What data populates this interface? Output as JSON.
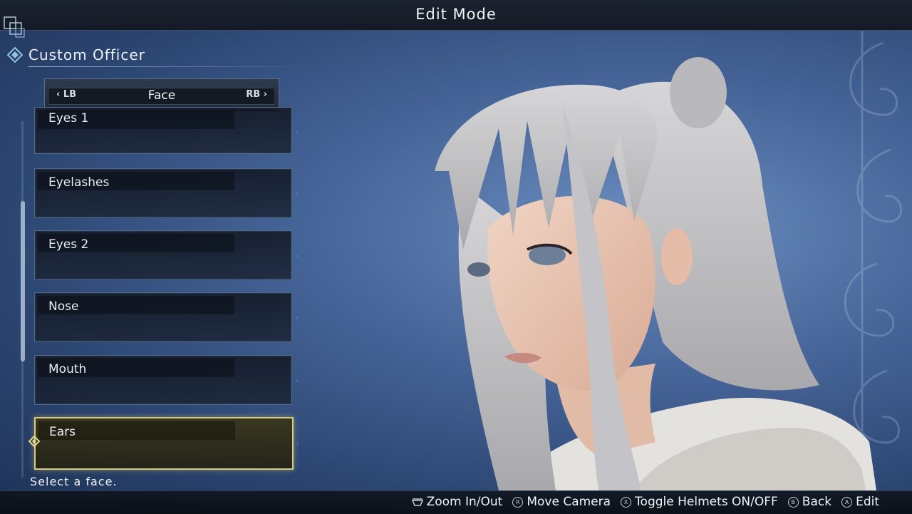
{
  "header": {
    "title": "Edit Mode"
  },
  "section": {
    "label": "Custom Officer"
  },
  "tab_selector": {
    "left_button": "LB",
    "right_button": "RB",
    "current_tab": "Face"
  },
  "menu": {
    "items": [
      {
        "label": "Eyes  1",
        "selected": false
      },
      {
        "label": "Eyelashes",
        "selected": false
      },
      {
        "label": "Eyes  2",
        "selected": false
      },
      {
        "label": "Nose",
        "selected": false
      },
      {
        "label": "Mouth",
        "selected": false
      },
      {
        "label": "Ears",
        "selected": true
      }
    ]
  },
  "hint_text": "Select  a  face.",
  "footer": {
    "controls": [
      {
        "icon": "trigger-icon",
        "label": "Zoom  In/Out"
      },
      {
        "icon": "r-stick-icon",
        "glyph": "R",
        "label": "Move  Camera"
      },
      {
        "icon": "x-button-icon",
        "glyph": "X",
        "label": "Toggle  Helmets  ON/OFF"
      },
      {
        "icon": "b-button-icon",
        "glyph": "B",
        "label": "Back"
      },
      {
        "icon": "a-button-icon",
        "glyph": "A",
        "label": "Edit"
      }
    ]
  },
  "colors": {
    "selection": "#d8cc7a",
    "panel_border": "#4f6a86",
    "background": "#47669a"
  }
}
